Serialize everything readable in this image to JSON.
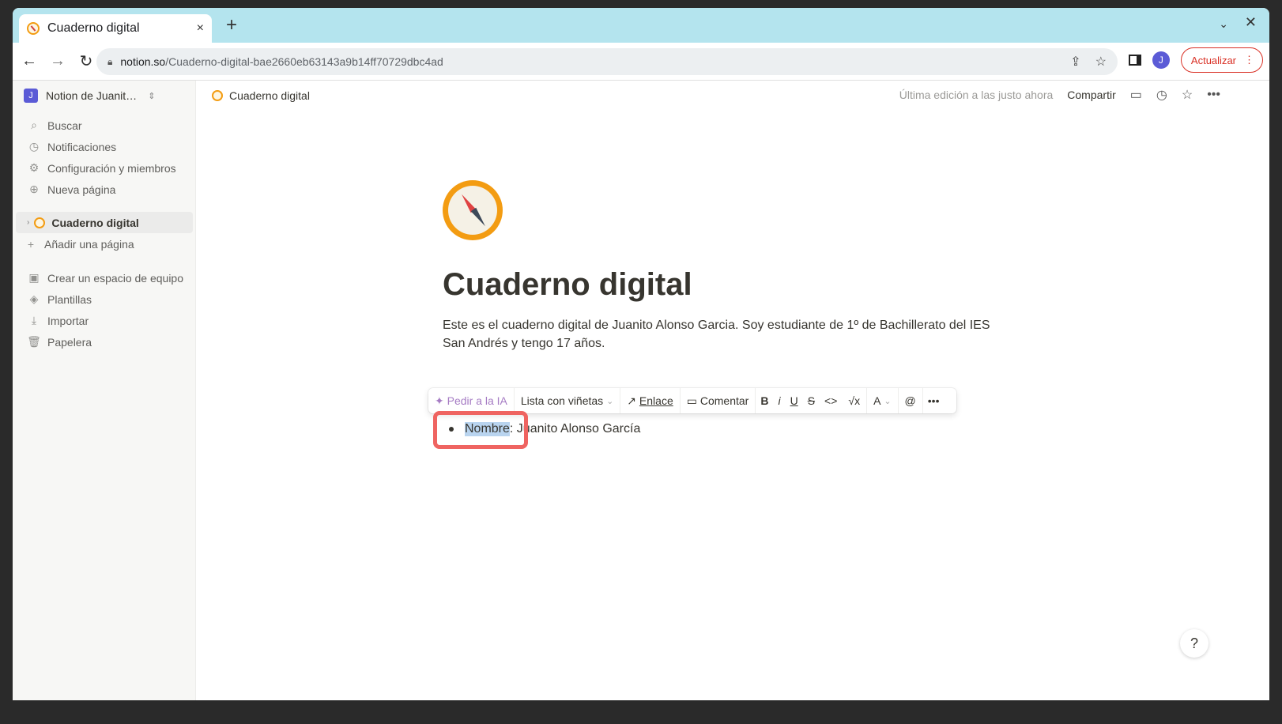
{
  "browser": {
    "tab_title": "Cuaderno digital",
    "tab_close": "×",
    "new_tab": "+",
    "url_host": "notion.so",
    "url_path": "/Cuaderno-digital-bae2660eb63143a9b14ff70729dbc4ad",
    "profile_initial": "J",
    "update_label": "Actualizar",
    "update_menu": "⋮"
  },
  "sidebar": {
    "workspace_initial": "J",
    "workspace_name": "Notion de Juanit…",
    "items": [
      {
        "label": "Buscar",
        "icon": "search-icon"
      },
      {
        "label": "Notificaciones",
        "icon": "clock-icon"
      },
      {
        "label": "Configuración y miembros",
        "icon": "gear-icon"
      },
      {
        "label": "Nueva página",
        "icon": "plus-circle-icon"
      }
    ],
    "page_label": "Cuaderno digital",
    "add_page": "Añadir una página",
    "bottom_items": [
      {
        "label": "Crear un espacio de equipo",
        "icon": "teamspace-icon"
      },
      {
        "label": "Plantillas",
        "icon": "templates-icon"
      },
      {
        "label": "Importar",
        "icon": "import-icon"
      },
      {
        "label": "Papelera",
        "icon": "trash-icon"
      }
    ]
  },
  "topbar": {
    "breadcrumb": "Cuaderno digital",
    "edited": "Última edición a las justo ahora",
    "share": "Compartir"
  },
  "page": {
    "title": "Cuaderno digital",
    "description": "Este es el cuaderno digital de Juanito Alonso Garcia. Soy estudiante de 1º de Bachillerato del IES San Andrés y tengo 17 años.",
    "bullet_selected": "Nombre",
    "bullet_rest": ": Juanito Alonso García"
  },
  "format_toolbar": {
    "ai": "Pedir a la IA",
    "block_type": "Lista con viñetas",
    "link": "Enlace",
    "comment": "Comentar",
    "bold": "B",
    "italic": "i",
    "underline": "U",
    "strike": "S",
    "code": "<>",
    "math": "√x",
    "color": "A",
    "mention": "@",
    "more": "•••"
  },
  "help": "?"
}
